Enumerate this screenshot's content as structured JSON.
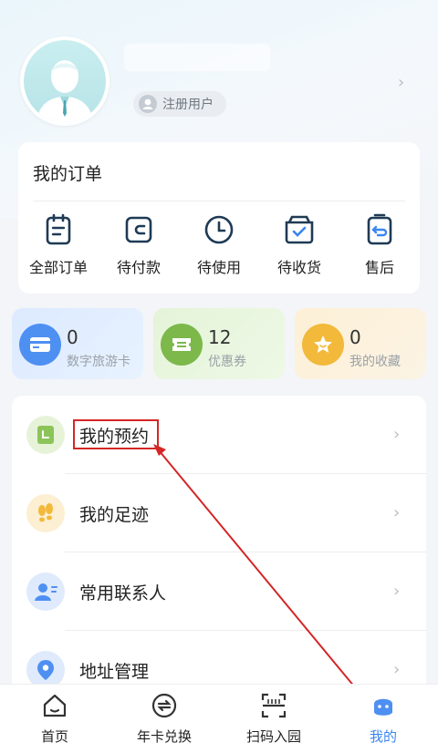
{
  "profile": {
    "badge_label": "注册用户",
    "icons": {
      "badge": "user-icon",
      "go": "chevron-right-icon"
    }
  },
  "orders": {
    "title": "我的订单",
    "items": [
      {
        "label": "全部订单",
        "icon": "order-list-icon"
      },
      {
        "label": "待付款",
        "icon": "wallet-icon"
      },
      {
        "label": "待使用",
        "icon": "clock-icon"
      },
      {
        "label": "待收货",
        "icon": "box-check-icon"
      },
      {
        "label": "售后",
        "icon": "return-icon"
      }
    ]
  },
  "stats": [
    {
      "value": "0",
      "label": "数字旅游卡",
      "icon": "card-icon",
      "color": "#4e8ff2"
    },
    {
      "value": "12",
      "label": "优惠券",
      "icon": "ticket-icon",
      "color": "#7cb84a"
    },
    {
      "value": "0",
      "label": "我的收藏",
      "icon": "star-icon",
      "color": "#f2b93b"
    }
  ],
  "menu": [
    {
      "label": "我的预约",
      "icon": "booking-icon",
      "color": "#8cc45a"
    },
    {
      "label": "我的足迹",
      "icon": "footprint-icon",
      "color": "#f2b93b"
    },
    {
      "label": "常用联系人",
      "icon": "contact-icon",
      "color": "#4e8ff2"
    },
    {
      "label": "地址管理",
      "icon": "location-icon",
      "color": "#4e8ff2"
    }
  ],
  "tabbar": [
    {
      "label": "首页",
      "icon": "home-icon",
      "active": false
    },
    {
      "label": "年卡兑换",
      "icon": "exchange-icon",
      "active": false
    },
    {
      "label": "扫码入园",
      "icon": "scan-icon",
      "active": false
    },
    {
      "label": "我的",
      "icon": "mine-icon",
      "active": true
    }
  ],
  "colors": {
    "accent": "#3a86f0",
    "annotation": "#d42626"
  }
}
